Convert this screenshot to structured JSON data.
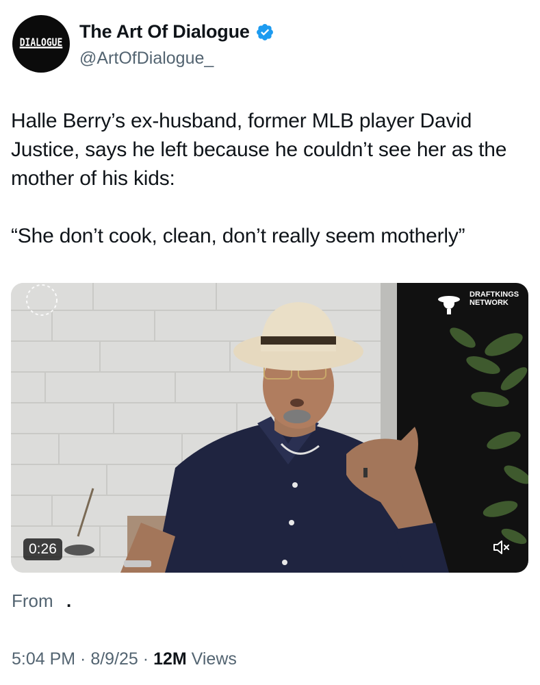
{
  "author": {
    "display_name": "The Art Of Dialogue",
    "handle": "@ArtOfDialogue_",
    "avatar_text": "DIALOGUE",
    "verified_color": "#1d9bf0"
  },
  "tweet": {
    "text": "Halle Berry’s ex-husband, former MLB player David Justice, says he left because he couldn’t see her as the mother of his kids:\n\n“She don’t cook, clean, don’t really seem motherly”"
  },
  "media": {
    "duration": "0:26",
    "watermark": "DRAFTKINGS\nNETWORK",
    "mute_icon": "speaker-muted-icon"
  },
  "source": {
    "label": "From",
    "dot": "."
  },
  "meta": {
    "time": "5:04 PM",
    "date": "8/9/25",
    "separator": " · ",
    "views_count": "12M",
    "views_label": "Views"
  }
}
